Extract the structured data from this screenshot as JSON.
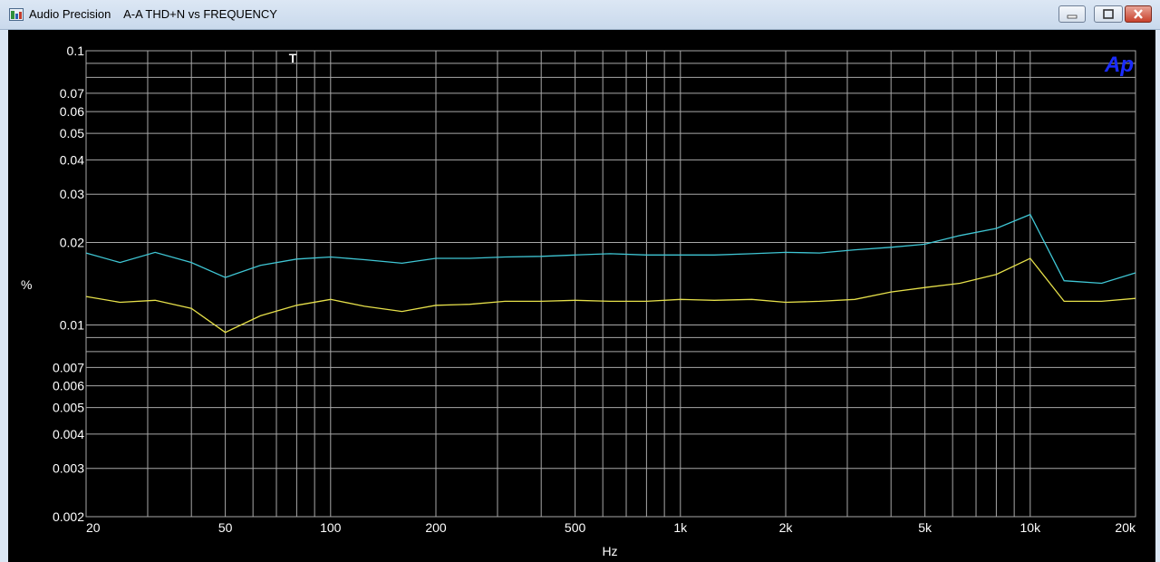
{
  "window": {
    "app_name": "Audio Precision",
    "title": "A-A THD+N vs FREQUENCY"
  },
  "colors": {
    "background": "#000000",
    "grid": "#a8a8a8",
    "text": "#ffffff",
    "series_cyan": "#3fc6d4",
    "series_yellow": "#e6e04a",
    "logo": "#1a2cff"
  },
  "chart_data": {
    "type": "line",
    "title": "",
    "xlabel": "Hz",
    "ylabel": "%",
    "xscale": "log",
    "yscale": "log",
    "xlim": [
      20,
      20000
    ],
    "ylim": [
      0.002,
      0.1
    ],
    "grid": true,
    "cursor_marker": "T",
    "logo_text": "Ap",
    "x_tick_labels": [
      {
        "value": 20,
        "label": "20"
      },
      {
        "value": 50,
        "label": "50"
      },
      {
        "value": 100,
        "label": "100"
      },
      {
        "value": 200,
        "label": "200"
      },
      {
        "value": 500,
        "label": "500"
      },
      {
        "value": 1000,
        "label": "1k"
      },
      {
        "value": 2000,
        "label": "2k"
      },
      {
        "value": 5000,
        "label": "5k"
      },
      {
        "value": 10000,
        "label": "10k"
      },
      {
        "value": 20000,
        "label": "20k"
      }
    ],
    "y_tick_labels": [
      {
        "value": 0.1,
        "label": "0.1"
      },
      {
        "value": 0.07,
        "label": "0.07"
      },
      {
        "value": 0.06,
        "label": "0.06"
      },
      {
        "value": 0.05,
        "label": "0.05"
      },
      {
        "value": 0.04,
        "label": "0.04"
      },
      {
        "value": 0.03,
        "label": "0.03"
      },
      {
        "value": 0.02,
        "label": "0.02"
      },
      {
        "value": 0.01,
        "label": "0.01"
      },
      {
        "value": 0.007,
        "label": "0.007"
      },
      {
        "value": 0.006,
        "label": "0.006"
      },
      {
        "value": 0.005,
        "label": "0.005"
      },
      {
        "value": 0.004,
        "label": "0.004"
      },
      {
        "value": 0.003,
        "label": "0.003"
      },
      {
        "value": 0.002,
        "label": "0.002"
      }
    ],
    "series": [
      {
        "color": "#3fc6d4",
        "x": [
          20,
          25,
          31.5,
          40,
          50,
          63,
          80,
          100,
          125,
          160,
          200,
          250,
          315,
          400,
          500,
          630,
          800,
          1000,
          1250,
          1600,
          2000,
          2500,
          3150,
          4000,
          5000,
          6300,
          8000,
          10000,
          12500,
          16000,
          20000
        ],
        "y": [
          0.0183,
          0.0169,
          0.0184,
          0.0169,
          0.0149,
          0.0165,
          0.0174,
          0.0177,
          0.0173,
          0.0168,
          0.0175,
          0.0175,
          0.0177,
          0.0178,
          0.018,
          0.0182,
          0.018,
          0.018,
          0.018,
          0.0182,
          0.0184,
          0.0183,
          0.0188,
          0.0192,
          0.0197,
          0.0212,
          0.0225,
          0.0253,
          0.0145,
          0.0142,
          0.0155
        ]
      },
      {
        "color": "#e6e04a",
        "x": [
          20,
          25,
          31.5,
          40,
          50,
          63,
          80,
          100,
          125,
          160,
          200,
          250,
          315,
          400,
          500,
          630,
          800,
          1000,
          1250,
          1600,
          2000,
          2500,
          3150,
          4000,
          5000,
          6300,
          8000,
          10000,
          12500,
          16000,
          20000
        ],
        "y": [
          0.0127,
          0.0121,
          0.0123,
          0.0115,
          0.0094,
          0.0108,
          0.0118,
          0.0124,
          0.0117,
          0.0112,
          0.0118,
          0.0119,
          0.0122,
          0.0122,
          0.0123,
          0.0122,
          0.0122,
          0.0124,
          0.0123,
          0.0124,
          0.0121,
          0.0122,
          0.0124,
          0.0132,
          0.0137,
          0.0142,
          0.0153,
          0.0175,
          0.0122,
          0.0122,
          0.0125
        ]
      }
    ]
  }
}
